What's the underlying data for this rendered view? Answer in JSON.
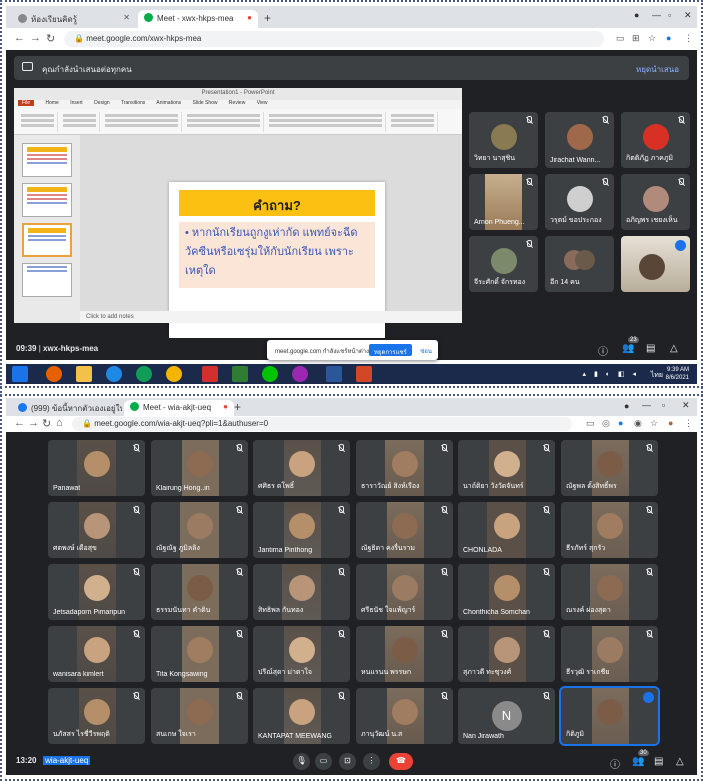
{
  "top": {
    "tabs": [
      {
        "label": "ห้องเรียนคิดรู้",
        "active": false
      },
      {
        "label": "Meet - xwx-hkps-mea",
        "active": true
      }
    ],
    "url": "meet.google.com/xwx-hkps-mea",
    "banner": {
      "text": "คุณกำลังนำเสนอต่อทุกคน",
      "stop": "หยุดนำเสนอ"
    },
    "ppt": {
      "window_title": "Presentation1 - PowerPoint",
      "file_tab": "File",
      "menu": [
        "Home",
        "Insert",
        "Design",
        "Transitions",
        "Animations",
        "Slide Show",
        "Review",
        "View"
      ],
      "notes": "Click to add notes",
      "slide_title": "คำถาม?",
      "slide_body": "• หากนักเรียนถูกงูเห่ากัด แพทย์จะฉีดวัคซีนหรือเซรุ่มให้กับนักเรียน เพราะเหตุใด"
    },
    "participants": [
      {
        "name": "วิทยา นาสุชิน"
      },
      {
        "name": "Jirachat Wann..."
      },
      {
        "name": "กิตติภัฏ ภาคภูมิ"
      },
      {
        "name": "Arnon Phueng..."
      },
      {
        "name": "วรุตม์ ขอประกอง"
      },
      {
        "name": "อภิญพร เชยงเห็น"
      },
      {
        "name": "จีระศักดิ์ จักรทอง"
      },
      {
        "name": "อีก 14 คน"
      },
      {
        "name": ""
      }
    ],
    "bottom": {
      "time": "09:39",
      "code": "xwx-hkps-mea",
      "people_count": "23"
    },
    "popup": {
      "message": "meet.google.com กำลังแชร์หน้าต่าง",
      "stop_button": "หยุดการแชร์",
      "hide": "ซ่อน"
    },
    "taskbar": {
      "lang": "ไทย",
      "time": "9:39 AM",
      "date": "8/6/2021"
    }
  },
  "bottom_screen": {
    "tabs": [
      {
        "label": "(999) ข้อนี้หากตัวเองเอยู่ใน...",
        "active": false
      },
      {
        "label": "Meet - wia-akjt-ueq",
        "active": true
      }
    ],
    "url": "meet.google.com/wia-akjt-ueq?pli=1&authuser=0",
    "participants": [
      {
        "name": "Panawat"
      },
      {
        "name": "Klairung Hong..in"
      },
      {
        "name": "ศศิธร ตโพธิ์"
      },
      {
        "name": "ธาราวัณย์ สิงห์เรือง"
      },
      {
        "name": "นาถ์ติยา วังวัดจันทร์"
      },
      {
        "name": "ณัฐพล ตั้งสิทธิ์พร"
      },
      {
        "name": "ศตพงษ์ เดือสุข"
      },
      {
        "name": "ณัฐณัฐ ภูมิลลิง"
      },
      {
        "name": "Jantima Pinthong"
      },
      {
        "name": "ณัฐธิดา คงรื่นราม"
      },
      {
        "name": "CHONLADA"
      },
      {
        "name": "ธีรภัทร์ สุกรัว"
      },
      {
        "name": "Jetsadaporn Pimaripun"
      },
      {
        "name": "ธรรมนันทา คำดิน"
      },
      {
        "name": "สิทธิพล กันทอง"
      },
      {
        "name": "ศรีธนัช ใจแพ้ญาร์"
      },
      {
        "name": "Chonthicha Somchan"
      },
      {
        "name": "ณรงค์ ผ่องสุดา"
      },
      {
        "name": "wanisara kimlert"
      },
      {
        "name": "Tita Kongsawing"
      },
      {
        "name": "ปรีณ์สุดา ม่าตาใจ"
      },
      {
        "name": "หนแรนน พรรษก"
      },
      {
        "name": "สุภาวดี ทะซุวงศ์"
      },
      {
        "name": "ธีรวุฒิ ราเกชีย"
      },
      {
        "name": "นภัสสร ไรชี่วีรพฤติ"
      },
      {
        "name": "สนเกษ ใจเรา"
      },
      {
        "name": "KANTAPAT MEEWANG"
      },
      {
        "name": "ภานุวัฒน์ น.ส"
      },
      {
        "name": "Nan Jirawath",
        "initial": "N"
      },
      {
        "name": "กิติภูมิ"
      }
    ],
    "bottom": {
      "time": "13:20",
      "code": "wia-akjt-ueq",
      "people_count": "30"
    }
  },
  "colors": {
    "meet_bg": "#202124",
    "tile_bg": "#3c4043",
    "accent": "#1a73e8",
    "end_call": "#ea4335",
    "slide_header": "#fcc012",
    "slide_body_bg": "#fbe5d6",
    "slide_text": "#3a56b8"
  }
}
